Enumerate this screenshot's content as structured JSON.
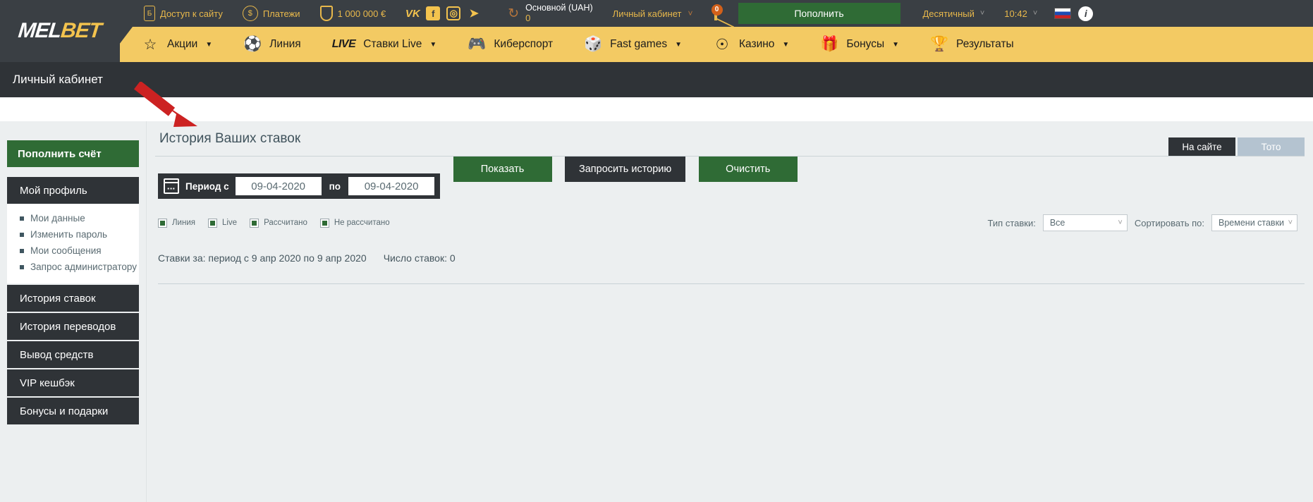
{
  "brand": {
    "part1": "MEL",
    "part2": "BET"
  },
  "topbar": {
    "items": [
      {
        "icon": "phone-icon",
        "glyph": "Б",
        "label": "Доступ к сайту"
      },
      {
        "icon": "dollar-coin-icon",
        "glyph": "$",
        "label": "Платежи"
      },
      {
        "icon": "shield-icon",
        "glyph": "",
        "label": "1 000 000 €"
      }
    ],
    "socials": [
      {
        "name": "vk-icon",
        "glyph": "VK"
      },
      {
        "name": "facebook-icon",
        "glyph": "f"
      },
      {
        "name": "instagram-icon",
        "glyph": "◎"
      },
      {
        "name": "telegram-icon",
        "glyph": "➤"
      }
    ],
    "account": {
      "refresh_icon": "refresh-icon",
      "name": "Основной (UAH)",
      "balance": "0"
    },
    "cabinet_label": "Личный кабинет",
    "messages_badge": "0",
    "deposit_label": "Пополнить",
    "odds_label": "Десятичный",
    "clock": "10:42",
    "language_flag": "ru-flag",
    "info_glyph": "i"
  },
  "nav": {
    "items": [
      {
        "icon": "star-icon",
        "glyph": "☆",
        "label": "Акции",
        "caret": "▼"
      },
      {
        "icon": "football-icon",
        "glyph": "⚽",
        "label": "Линия",
        "caret": ""
      },
      {
        "icon": "live-badge",
        "glyph": "LIVE",
        "label": "Ставки Live",
        "caret": "▼"
      },
      {
        "icon": "gamepad-icon",
        "glyph": "🎮",
        "label": "Киберспорт",
        "caret": ""
      },
      {
        "icon": "dice-icon",
        "glyph": "🎲",
        "label": "Fast games",
        "caret": "▼"
      },
      {
        "icon": "casino-chip-icon",
        "glyph": "☉",
        "label": "Казино",
        "caret": "▼"
      },
      {
        "icon": "gift-icon",
        "glyph": "🎁",
        "label": "Бонусы",
        "caret": "▼"
      },
      {
        "icon": "podium-icon",
        "glyph": "🏆",
        "label": "Результаты",
        "caret": ""
      }
    ]
  },
  "breadcrumb": "Личный кабинет",
  "sidebar": {
    "deposit_label": "Пополнить счёт",
    "profile_label": "Мой профиль",
    "profile_items": [
      "Мои данные",
      "Изменить пароль",
      "Мои сообщения",
      "Запрос администратору"
    ],
    "sections": [
      "История ставок",
      "История переводов",
      "Вывод средств",
      "VIP кешбэк",
      "Бонусы и подарки"
    ]
  },
  "main": {
    "title": "История Ваших ставок",
    "tabs": [
      {
        "label": "На сайте",
        "active": true
      },
      {
        "label": "Тото",
        "active": false
      }
    ],
    "filter": {
      "calendar_icon": "calendar-icon",
      "period_label": "Период с",
      "date_from": "09-04-2020",
      "between_label": "по",
      "date_to": "09-04-2020",
      "buttons": [
        {
          "label": "Показать",
          "style": "green"
        },
        {
          "label": "Запросить историю",
          "style": "dark"
        },
        {
          "label": "Очистить",
          "style": "green"
        }
      ]
    },
    "checkboxes": [
      {
        "label": "Линия",
        "checked": true
      },
      {
        "label": "Live",
        "checked": true
      },
      {
        "label": "Рассчитано",
        "checked": true
      },
      {
        "label": "Не рассчитано",
        "checked": true
      }
    ],
    "selects": [
      {
        "label": "Тип ставки:",
        "value": "Все"
      },
      {
        "label": "Сортировать по:",
        "value": "Времени ставки"
      }
    ],
    "summary_period": "Ставки за: период с 9 апр 2020 по 9 апр 2020",
    "summary_count": "Число ставок: 0"
  },
  "colors": {
    "dark": "#3a3f44",
    "yellow": "#f3ca63",
    "gold_text": "#e8b84b",
    "green": "#2f6b35",
    "panel": "#eceff0",
    "arrow_red": "#cc2222"
  }
}
